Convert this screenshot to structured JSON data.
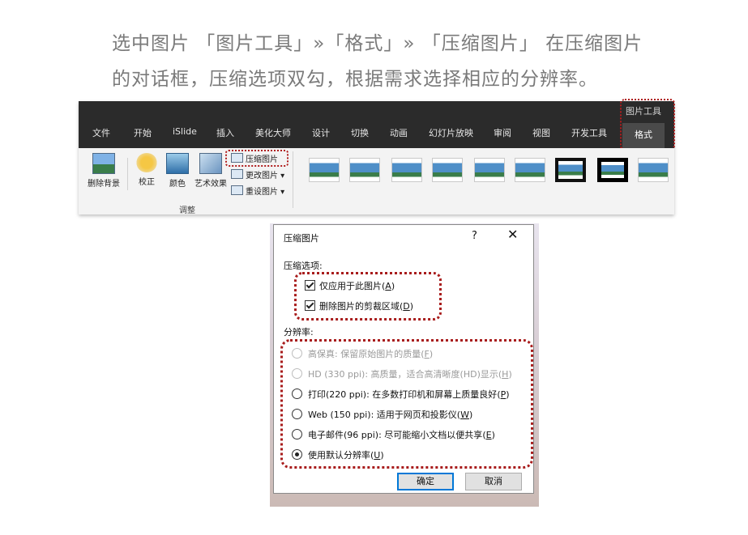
{
  "caption": {
    "line1": "选中图片 「图片工具」»「格式」» 「压缩图片」 在压缩图片",
    "line2": "的对话框，压缩选项双勾，根据需求选择相应的分辨率。"
  },
  "ribbon": {
    "context_tab_group": "图片工具",
    "tabs": [
      "文件",
      "开始",
      "iSlide",
      "插入",
      "美化大师",
      "设计",
      "切换",
      "动画",
      "幻灯片放映",
      "审阅",
      "视图",
      "开发工具",
      "格式"
    ],
    "active_tab": "格式",
    "buttons": {
      "remove_bg": "删除背景",
      "correct": "校正",
      "color": "颜色",
      "artistic": "艺术效果",
      "compress": "压缩图片",
      "change": "更改图片",
      "reset": "重设图片"
    },
    "group_label": "调整"
  },
  "dialog": {
    "title": "压缩图片",
    "help": "?",
    "close": "✕",
    "compress_section": "压缩选项:",
    "options": [
      {
        "label": "仅应用于此图片",
        "key": "A",
        "checked": true
      },
      {
        "label": "删除图片的剪裁区域",
        "key": "D",
        "checked": true
      }
    ],
    "resolution_section": "分辨率:",
    "resolutions": [
      {
        "label": "高保真: 保留原始图片的质量",
        "key": "F",
        "enabled": false,
        "selected": false
      },
      {
        "label": "HD (330 ppi): 高质量，适合高清晰度(HD)显示",
        "key": "H",
        "enabled": false,
        "selected": false
      },
      {
        "label": "打印(220 ppi): 在多数打印机和屏幕上质量良好",
        "key": "P",
        "enabled": true,
        "selected": false
      },
      {
        "label": "Web (150 ppi): 适用于网页和投影仪",
        "key": "W",
        "enabled": true,
        "selected": false
      },
      {
        "label": "电子邮件(96 ppi): 尽可能缩小文档以便共享",
        "key": "E",
        "enabled": true,
        "selected": false
      },
      {
        "label": "使用默认分辨率",
        "key": "U",
        "enabled": true,
        "selected": true
      }
    ],
    "ok": "确定",
    "cancel": "取消"
  }
}
